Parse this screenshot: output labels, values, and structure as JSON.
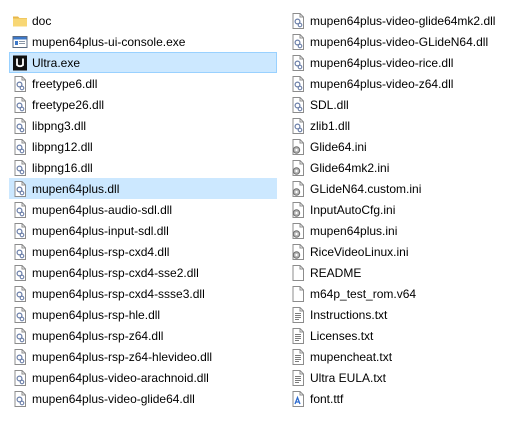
{
  "files_left": [
    {
      "name": "doc",
      "icon": "folder-icon",
      "selected": false
    },
    {
      "name": "mupen64plus-ui-console.exe",
      "icon": "console-app-icon",
      "selected": false
    },
    {
      "name": "Ultra.exe",
      "icon": "ultra-app-icon",
      "selected": true
    },
    {
      "name": "freetype6.dll",
      "icon": "dll-file-icon",
      "selected": false
    },
    {
      "name": "freetype26.dll",
      "icon": "dll-file-icon",
      "selected": false
    },
    {
      "name": "libpng3.dll",
      "icon": "dll-file-icon",
      "selected": false
    },
    {
      "name": "libpng12.dll",
      "icon": "dll-file-icon",
      "selected": false
    },
    {
      "name": "libpng16.dll",
      "icon": "dll-file-icon",
      "selected": false
    },
    {
      "name": "mupen64plus.dll",
      "icon": "dll-file-icon",
      "selected": true
    },
    {
      "name": "mupen64plus-audio-sdl.dll",
      "icon": "dll-file-icon",
      "selected": false
    },
    {
      "name": "mupen64plus-input-sdl.dll",
      "icon": "dll-file-icon",
      "selected": false
    },
    {
      "name": "mupen64plus-rsp-cxd4.dll",
      "icon": "dll-file-icon",
      "selected": false
    },
    {
      "name": "mupen64plus-rsp-cxd4-sse2.dll",
      "icon": "dll-file-icon",
      "selected": false
    },
    {
      "name": "mupen64plus-rsp-cxd4-ssse3.dll",
      "icon": "dll-file-icon",
      "selected": false
    },
    {
      "name": "mupen64plus-rsp-hle.dll",
      "icon": "dll-file-icon",
      "selected": false
    },
    {
      "name": "mupen64plus-rsp-z64.dll",
      "icon": "dll-file-icon",
      "selected": false
    },
    {
      "name": "mupen64plus-rsp-z64-hlevideo.dll",
      "icon": "dll-file-icon",
      "selected": false
    },
    {
      "name": "mupen64plus-video-arachnoid.dll",
      "icon": "dll-file-icon",
      "selected": false
    },
    {
      "name": "mupen64plus-video-glide64.dll",
      "icon": "dll-file-icon",
      "selected": false
    }
  ],
  "files_right": [
    {
      "name": "mupen64plus-video-glide64mk2.dll",
      "icon": "dll-file-icon",
      "selected": false
    },
    {
      "name": "mupen64plus-video-GLideN64.dll",
      "icon": "dll-file-icon",
      "selected": false
    },
    {
      "name": "mupen64plus-video-rice.dll",
      "icon": "dll-file-icon",
      "selected": false
    },
    {
      "name": "mupen64plus-video-z64.dll",
      "icon": "dll-file-icon",
      "selected": false
    },
    {
      "name": "SDL.dll",
      "icon": "dll-file-icon",
      "selected": false
    },
    {
      "name": "zlib1.dll",
      "icon": "dll-file-icon",
      "selected": false
    },
    {
      "name": "Glide64.ini",
      "icon": "ini-file-icon",
      "selected": false
    },
    {
      "name": "Glide64mk2.ini",
      "icon": "ini-file-icon",
      "selected": false
    },
    {
      "name": "GLideN64.custom.ini",
      "icon": "ini-file-icon",
      "selected": false
    },
    {
      "name": "InputAutoCfg.ini",
      "icon": "ini-file-icon",
      "selected": false
    },
    {
      "name": "mupen64plus.ini",
      "icon": "ini-file-icon",
      "selected": false
    },
    {
      "name": "RiceVideoLinux.ini",
      "icon": "ini-file-icon",
      "selected": false
    },
    {
      "name": "README",
      "icon": "blank-file-icon",
      "selected": false
    },
    {
      "name": "m64p_test_rom.v64",
      "icon": "blank-file-icon",
      "selected": false
    },
    {
      "name": "Instructions.txt",
      "icon": "text-file-icon",
      "selected": false
    },
    {
      "name": "Licenses.txt",
      "icon": "text-file-icon",
      "selected": false
    },
    {
      "name": "mupencheat.txt",
      "icon": "text-file-icon",
      "selected": false
    },
    {
      "name": "Ultra EULA.txt",
      "icon": "text-file-icon",
      "selected": false
    },
    {
      "name": "font.ttf",
      "icon": "font-file-icon",
      "selected": false
    }
  ],
  "colors": {
    "selection_background": "#cce8ff",
    "selection_border": "#99d1ff",
    "folder_yellow": "#f8d775",
    "text": "#000000"
  }
}
